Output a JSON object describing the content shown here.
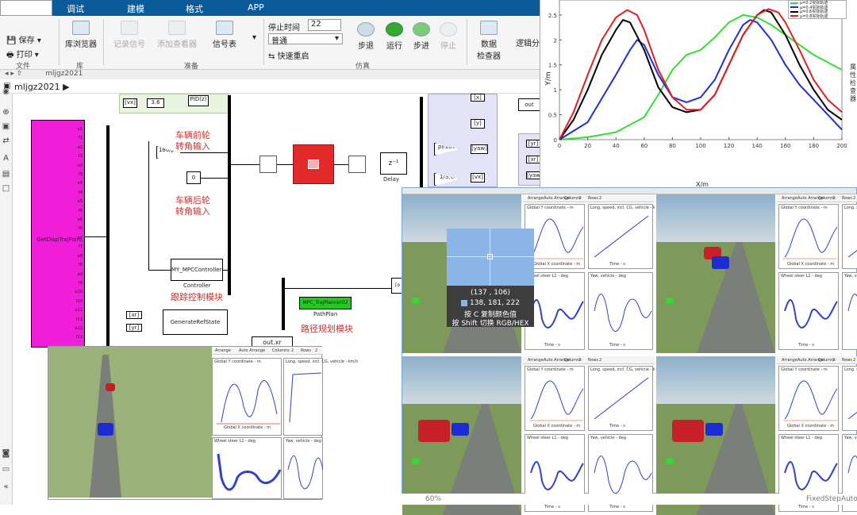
{
  "tabs": [
    "调试",
    "建模",
    "格式",
    "APP"
  ],
  "ribbon": {
    "file": {
      "save": "保存",
      "print": "打印",
      "group": "文件"
    },
    "library": {
      "browser": "库浏览器",
      "group": "库"
    },
    "prepare": {
      "record": "记录信号",
      "add_viewer": "添加查看器",
      "signal_table": "信号表",
      "group": "准备"
    },
    "simulate": {
      "stop_time_label": "停止时间",
      "stop_time_value": "22",
      "mode": "普通",
      "fast_restart": "快速重启",
      "step_back": "步退",
      "run": "运行",
      "step_forward": "步进",
      "stop": "停止",
      "group": "仿真"
    },
    "review": {
      "data_inspector": "数据\n检查器",
      "logic": "逻辑分"
    }
  },
  "address": "mljgz2021",
  "breadcrumb": "mljgz2021 ▶",
  "canvas": {
    "label_front": "车辆前轮\n转角输入",
    "label_rear": "车辆后轮\n转角输入",
    "label_track": "跟踪控制模块",
    "label_path": "路径规划模块",
    "block_getdisp": "GetDispTrajPoint",
    "block_controller_top": "MY_MPCController02",
    "block_controller_bottom": "Controller",
    "block_pathplan_top": "MPC_TrajPlanner02",
    "block_pathplan_bottom": "PathPlan",
    "block_refstate": "GenerateRefState",
    "block_pid": "PID(z)",
    "block_delay": "Delay",
    "block_zinv": "z⁻¹",
    "gain_180": "180/pi",
    "gain_pi180": "pi/180",
    "gain_13_6": "1/3.6",
    "gain_36": "3.6",
    "const_0": "0",
    "port_vx": "[vx]",
    "port_y": "[y]",
    "port_yaw": "[yaw]",
    "port_x": "[x]",
    "port_xr": "[xr]",
    "port_yr": "[yr]",
    "out_xr": "out.xr",
    "out_label": "out",
    "inports": [
      "e1",
      "f1",
      "e2",
      "f2",
      "e3",
      "f3",
      "e4",
      "f4",
      "e5",
      "f5",
      "e6",
      "f6",
      "e7",
      "f7",
      "e8",
      "f8",
      "e9",
      "f9",
      "e10",
      "f10",
      "e11",
      "f11",
      "e12",
      "f12"
    ]
  },
  "plot": {
    "ylabel": "Y/m",
    "xlabel": "X/m",
    "legend": [
      "μ=0.2实际轨迹",
      "μ=0.4实际轨迹",
      "μ=0.6实际轨迹",
      "μ=0.8实际轨迹"
    ],
    "colors": [
      "#33dd33",
      "#1f2fd6",
      "#000000",
      "#e41e1e"
    ],
    "side_text": "属性检查器"
  },
  "chart_data": {
    "type": "line",
    "xlabel": "X/m",
    "ylabel": "Y/m",
    "xlim": [
      0,
      200
    ],
    "ylim": [
      0,
      2.8
    ],
    "xticks": [
      0,
      20,
      40,
      60,
      80,
      100,
      120,
      140,
      160,
      180,
      200
    ],
    "yticks": [
      0,
      0.5,
      1,
      1.5,
      2,
      2.5
    ],
    "series": [
      {
        "name": "μ=0.2实际轨迹",
        "color": "#33dd33",
        "x": [
          0,
          20,
          40,
          60,
          70,
          80,
          90,
          100,
          110,
          120,
          130,
          140,
          150,
          160,
          170,
          180,
          190,
          200
        ],
        "y": [
          0,
          0.05,
          0.15,
          0.45,
          0.9,
          1.4,
          1.7,
          1.8,
          2.05,
          2.35,
          2.5,
          2.45,
          2.3,
          2.1,
          1.9,
          1.7,
          1.55,
          1.4
        ]
      },
      {
        "name": "μ=0.4实际轨迹",
        "color": "#1f2fd6",
        "x": [
          0,
          20,
          40,
          50,
          55,
          60,
          70,
          80,
          90,
          100,
          110,
          120,
          130,
          135,
          140,
          150,
          160,
          170,
          180,
          190,
          200
        ],
        "y": [
          0,
          0.35,
          1.3,
          1.8,
          2.0,
          1.9,
          1.3,
          0.85,
          0.75,
          0.85,
          1.2,
          1.8,
          2.3,
          2.4,
          2.35,
          2.0,
          1.5,
          1.1,
          0.8,
          0.5,
          0.2
        ]
      },
      {
        "name": "μ=0.6实际轨迹",
        "color": "#000000",
        "x": [
          0,
          10,
          20,
          30,
          40,
          45,
          50,
          60,
          70,
          80,
          90,
          100,
          110,
          120,
          130,
          140,
          145,
          150,
          160,
          170,
          180,
          190,
          200
        ],
        "y": [
          0,
          0.4,
          1.0,
          1.7,
          2.2,
          2.4,
          2.35,
          1.8,
          1.05,
          0.65,
          0.55,
          0.6,
          0.9,
          1.5,
          2.1,
          2.5,
          2.6,
          2.55,
          2.1,
          1.5,
          1.0,
          0.6,
          0.4
        ]
      },
      {
        "name": "μ=0.8实际轨迹",
        "color": "#e41e1e",
        "x": [
          0,
          10,
          20,
          30,
          40,
          48,
          55,
          60,
          70,
          80,
          90,
          100,
          110,
          120,
          130,
          140,
          148,
          155,
          160,
          170,
          180,
          190,
          200
        ],
        "y": [
          0,
          0.55,
          1.3,
          2.0,
          2.45,
          2.6,
          2.5,
          2.2,
          1.4,
          0.85,
          0.6,
          0.6,
          0.9,
          1.5,
          2.1,
          2.5,
          2.62,
          2.55,
          2.35,
          1.8,
          1.2,
          0.8,
          0.55
        ]
      }
    ]
  },
  "picker": {
    "coords": "(137 , 106)",
    "rgb": "138, 181, 222",
    "color": "#8ab5e6",
    "hint1": "按 C 复制颜色值",
    "hint2": "按 Shift 切换 RGB/HEX"
  },
  "scope": {
    "arrange": "Arrange",
    "auto_arrange": "Auto Arrange",
    "columns": "Columns",
    "columns_val": "2",
    "rows": "Rows",
    "rows_val": "2",
    "t1": "Global Y coordinate - m",
    "t2": "Long. speed, incl. CG, vehicle - km/h",
    "t3": "Wheel steer L1 - deg",
    "t4": "Yaw, vehicle - deg",
    "sub1": "Global X coordinate - m",
    "sub2": "Time - s",
    "axis3": "Time - s",
    "axis4": "Time - s"
  },
  "status": {
    "left": "60%",
    "right": "FixedStepAuto"
  }
}
